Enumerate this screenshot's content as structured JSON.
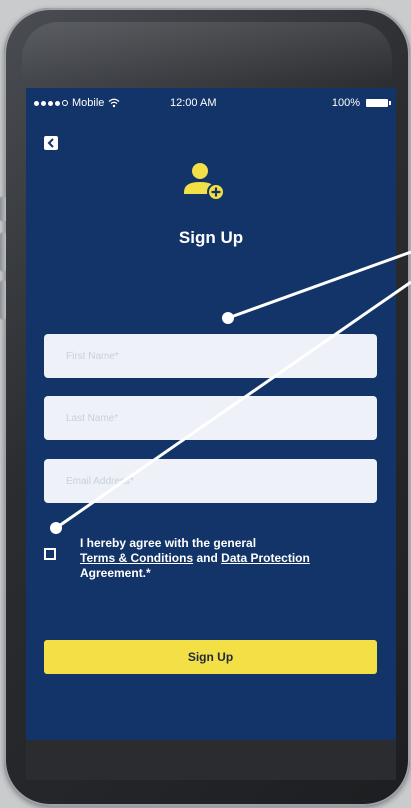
{
  "status_bar": {
    "carrier": "Mobile",
    "time": "12:00 AM",
    "battery": "100%"
  },
  "header": {
    "back_icon": "chevron-left-icon",
    "user_icon": "user-add-icon",
    "title": "Sign Up"
  },
  "form": {
    "first_name_placeholder": "First Name*",
    "last_name_placeholder": "Last Name*",
    "email_placeholder": "Email Address*"
  },
  "agreement": {
    "text_prefix": "I hereby agree with the general",
    "terms_link": "Terms & Conditions",
    "and": "and",
    "data_link": "Data Protection",
    "text_suffix": "Agreement.*"
  },
  "submit": {
    "label": "Sign Up"
  },
  "colors": {
    "screen_bg": "#133468",
    "accent": "#f3df46",
    "field_bg": "#eef1f7"
  }
}
